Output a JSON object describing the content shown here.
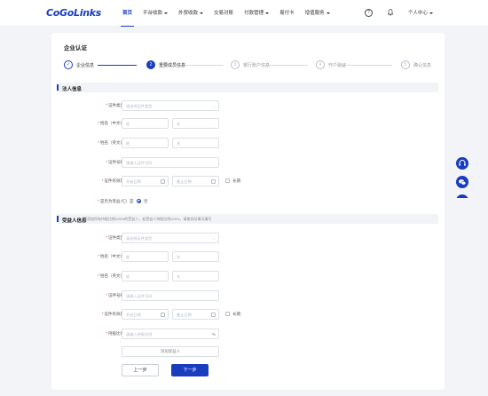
{
  "header": {
    "logo": "CoGoLinks",
    "nav": [
      {
        "label": "首页",
        "active": true,
        "caret": false
      },
      {
        "label": "平台收款",
        "active": false,
        "caret": true
      },
      {
        "label": "外贸收款",
        "active": false,
        "caret": true
      },
      {
        "label": "交易对账",
        "active": false,
        "caret": false
      },
      {
        "label": "付款管理",
        "active": false,
        "caret": true
      },
      {
        "label": "易付卡",
        "active": false,
        "caret": false
      },
      {
        "label": "增值服务",
        "active": false,
        "caret": true
      }
    ],
    "help_icon_glyph": "?",
    "user_menu": "个人中心"
  },
  "page": {
    "title": "企业认证",
    "steps": [
      {
        "num": "✓",
        "label": "企业信息",
        "state": "done"
      },
      {
        "num": "2",
        "label": "重要成员信息",
        "state": "current"
      },
      {
        "num": "3",
        "label": "银行账户信息",
        "state": "todo"
      },
      {
        "num": "4",
        "label": "开户验证",
        "state": "todo"
      },
      {
        "num": "5",
        "label": "确认信息",
        "state": "todo"
      }
    ]
  },
  "legal_person": {
    "section_title": "法人信息",
    "id_type_label": "证件类型",
    "id_type_placeholder": "请选择证件类型",
    "name_cn_label": "姓名（中文）",
    "surname_ph": "姓",
    "given_name_ph": "名",
    "name_en_label": "姓名（英文）",
    "id_number_label": "证件号码",
    "id_number_placeholder": "请输入证件号码",
    "id_validity_label": "证件有效期",
    "start_date_ph": "开始日期",
    "end_date_ph": "截止日期",
    "long_term_label": "长期",
    "is_beneficiary_label": "是否为受益人",
    "yes_label": "是",
    "no_label": "否",
    "is_beneficiary_selected": "否"
  },
  "beneficiary": {
    "section_title": "受益人信息",
    "hint": "请添加所有持股比例≥25%的受益人，若受益人持股比例≥25%，请按实际情况填写",
    "id_type_label": "证件类型",
    "id_type_placeholder": "请选择证件类型",
    "name_cn_label": "姓名（中文）",
    "surname_ph": "姓",
    "given_name_ph": "名",
    "name_en_label": "姓名（英文）",
    "id_number_label": "证件号码",
    "id_number_placeholder": "请输入证件号码",
    "id_validity_label": "证件有效期",
    "start_date_ph": "开始日期",
    "end_date_ph": "截止日期",
    "long_term_label": "长期",
    "share_ratio_label": "持股比例",
    "share_ratio_placeholder": "请输入持股比例",
    "share_ratio_suffix": "%",
    "add_label": "添加受益人"
  },
  "actions": {
    "prev_label": "上一步",
    "next_label": "下一步"
  },
  "colors": {
    "primary": "#1a3dc0",
    "required": "#e2413a"
  }
}
